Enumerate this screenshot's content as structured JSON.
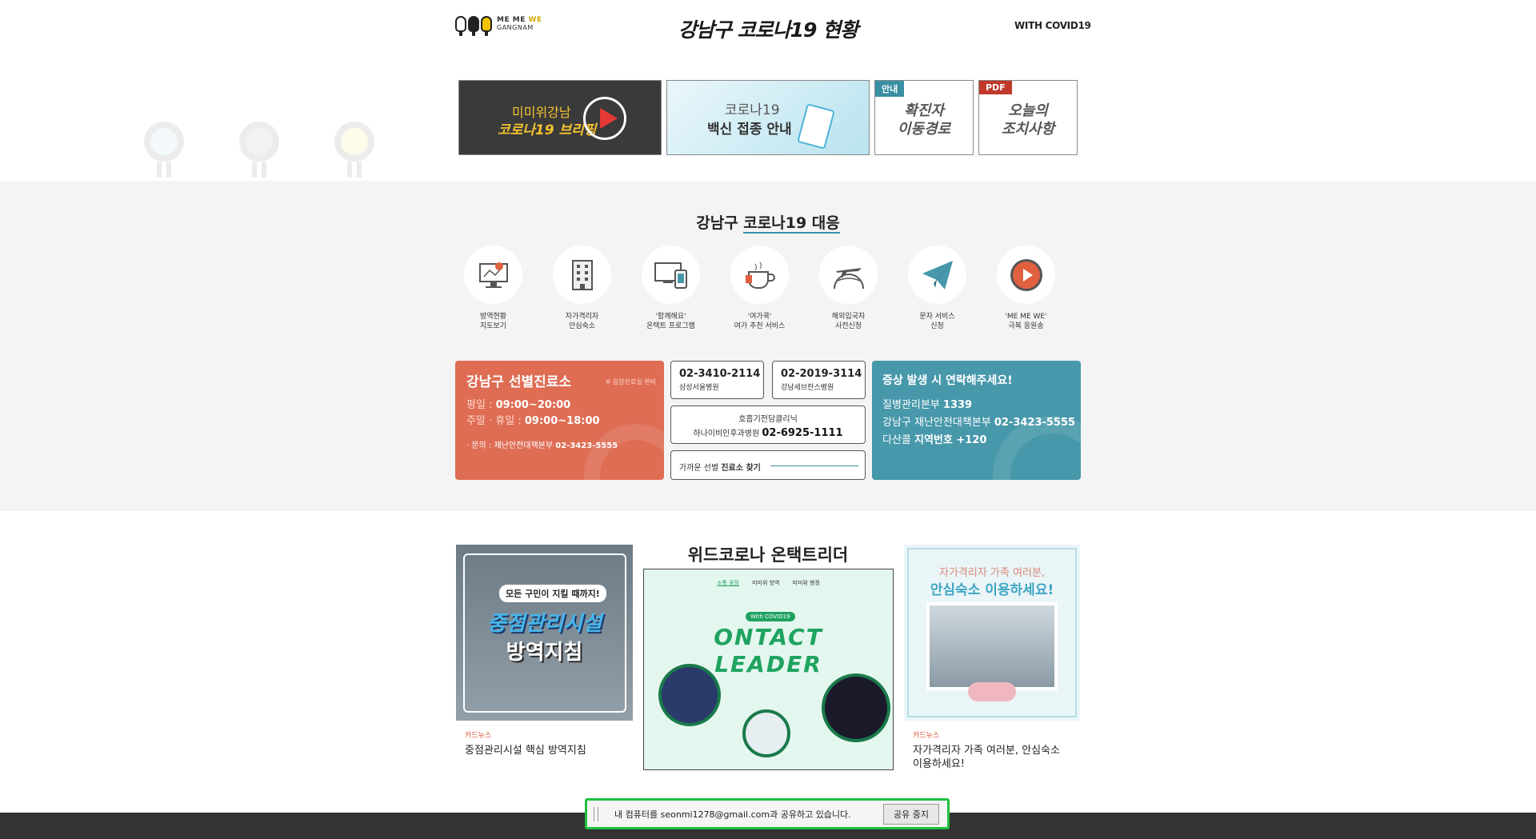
{
  "header": {
    "logo_line1_a": "ME ME ",
    "logo_line1_b": "WE",
    "logo_line2": "GANGNAM",
    "title": "강남구 코로나19 현황",
    "with_label": "WITH COVID19"
  },
  "banners": [
    {
      "line1": "미미위강남",
      "line2": "코로나19 브리핑"
    },
    {
      "line1": "코로나19",
      "line2": "백신 접종 안내"
    },
    {
      "tag": "안내",
      "line1": "확진자",
      "line2": "이동경로"
    },
    {
      "tag": "PDF",
      "line1": "오늘의",
      "line2": "조치사항"
    }
  ],
  "response": {
    "title_a": "강남구 ",
    "title_b": "코로나19 대응",
    "icons": [
      {
        "icon": "map-pin-monitor-icon",
        "line1": "방역현황",
        "line2": "지도보기"
      },
      {
        "icon": "building-icon",
        "line1": "자가격리자",
        "line2": "안심숙소"
      },
      {
        "icon": "devices-icon",
        "line1": "'함께해요'",
        "line2": "온택트 프로그램"
      },
      {
        "icon": "coffee-cup-icon",
        "line1": "'여가쿡'",
        "line2": "여가 추천 서비스"
      },
      {
        "icon": "airplane-globe-icon",
        "line1": "해외입국자",
        "line2": "사전신청"
      },
      {
        "icon": "paper-plane-icon",
        "line1": "문자 서비스",
        "line2": "신청"
      },
      {
        "icon": "play-circle-icon",
        "line1": "'ME ME WE'",
        "line2": "극복 응원송"
      }
    ]
  },
  "clinic": {
    "title": "강남구 선별진료소",
    "note": "※ 음압진료실 완비",
    "weekday_label": "평일 : ",
    "weekday_hours": "09:00~20:00",
    "weekend_label": "주말 · 휴일 : ",
    "weekend_hours": "09:00~18:00",
    "inquiry_label": "· 문의 : 재난안전대책본부 ",
    "inquiry_number": "02-3423-5555"
  },
  "hospitals": [
    {
      "number": "02-3410-2114",
      "name": "삼성서울병원"
    },
    {
      "number": "02-2019-3114",
      "name": "강남세브란스병원"
    }
  ],
  "respiratory": {
    "line1": "호흡기전담클리닉",
    "hospital": "하나이비인후과병원 ",
    "number": "02-6925-1111"
  },
  "nearby": {
    "prefix": "가까운 선별 ",
    "bold": "진료소 찾기"
  },
  "contact": {
    "title": "증상 발생 시 연락해주세요!",
    "rows": [
      {
        "label": "질병관리본부 ",
        "value": "1339"
      },
      {
        "label": "강남구 재난안전대책본부 ",
        "value": "02-3423-5555"
      },
      {
        "label": "다산콜 ",
        "value": "지역번호 +120"
      }
    ]
  },
  "with_corona": {
    "title": "위드코로나 온택트리더",
    "left": {
      "bubble": "모든 구민이 지킬 때까지!",
      "big1": "중점관리시설",
      "big2": "방역지침",
      "category": "카드뉴스",
      "caption": "중점관리시설 핵심 방역지침"
    },
    "middle": {
      "nav": [
        "소통 광장",
        "미미위 방역",
        "미미위 행정"
      ],
      "tag": "With COVID19",
      "big1": "ONTACT",
      "big2": "LEADER"
    },
    "right": {
      "line1": "자가격리자 가족 여러분,",
      "line2": "안심숙소 이용하세요!",
      "category": "카드뉴스",
      "caption_line1": "자가격리자 가족 여러분, 안심숙소",
      "caption_line2": "이용하세요!"
    }
  },
  "share_bar": {
    "message": "내 컴퓨터를 seonmi1278@gmail.com과 공유하고 있습니다.",
    "stop_label": "공유 중지"
  },
  "colors": {
    "clinic": "#de6d54",
    "contact": "#4798aa",
    "accent": "#3a8fa3",
    "share_border": "#1fbf40"
  }
}
